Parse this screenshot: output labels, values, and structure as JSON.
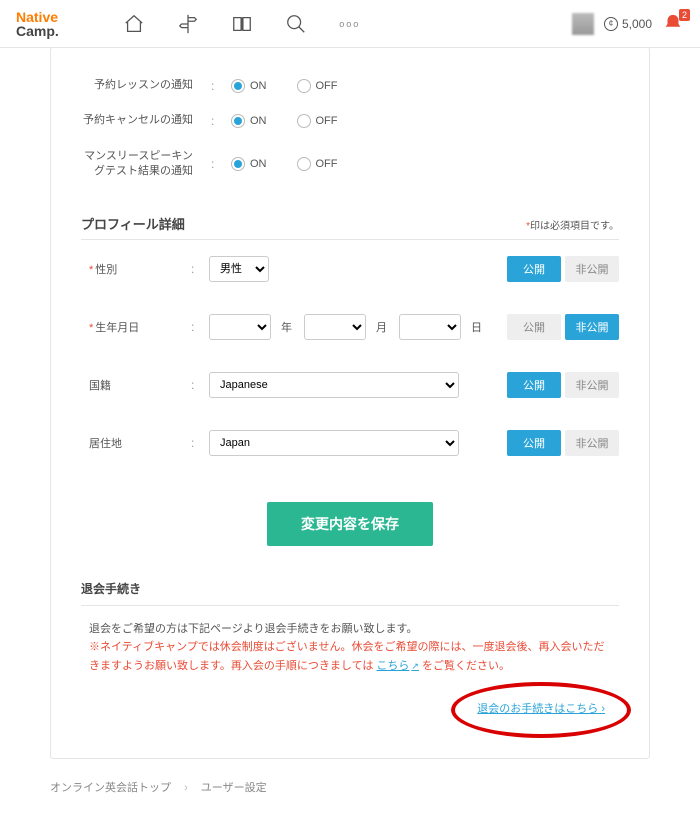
{
  "header": {
    "logo_top": "Native",
    "logo_bottom": "Camp.",
    "coins": "5,000",
    "bell_badge": "2"
  },
  "notifications": {
    "rows": [
      {
        "label": "予約レッスンの通知",
        "on": "ON",
        "off": "OFF"
      },
      {
        "label": "予約キャンセルの通知",
        "on": "ON",
        "off": "OFF"
      },
      {
        "label": "マンスリースピーキングテスト結果の通知",
        "on": "ON",
        "off": "OFF"
      }
    ]
  },
  "profile": {
    "section_title": "プロフィール詳細",
    "required_note_prefix": "*",
    "required_note": "印は必須項目です。",
    "rows": {
      "gender": {
        "label": "性別",
        "required": true,
        "value": "男性",
        "public": "公開",
        "private": "非公開",
        "active": "public"
      },
      "birthday": {
        "label": "生年月日",
        "required": true,
        "year_unit": "年",
        "month_unit": "月",
        "day_unit": "日",
        "public": "公開",
        "private": "非公開",
        "active": "private"
      },
      "nationality": {
        "label": "国籍",
        "required": false,
        "value": "Japanese",
        "public": "公開",
        "private": "非公開",
        "active": "public"
      },
      "residence": {
        "label": "居住地",
        "required": false,
        "value": "Japan",
        "public": "公開",
        "private": "非公開",
        "active": "public"
      }
    }
  },
  "save_button": "変更内容を保存",
  "withdraw": {
    "title": "退会手続き",
    "line1": "退会をご希望の方は下記ページより退会手続きをお願い致します。",
    "note_pre": "※ネイティブキャンプでは休会制度はございません。休会をご希望の際には、一度退会後、再入会いただきますようお願い致します。再入会の手順につきましては ",
    "note_link": "こちら",
    "note_post": " をご覧ください。",
    "cta": "退会のお手続きはこちら",
    "cta_arrow": " ›"
  },
  "breadcrumb": {
    "top": "オンライン英会話トップ",
    "current": "ユーザー設定"
  }
}
